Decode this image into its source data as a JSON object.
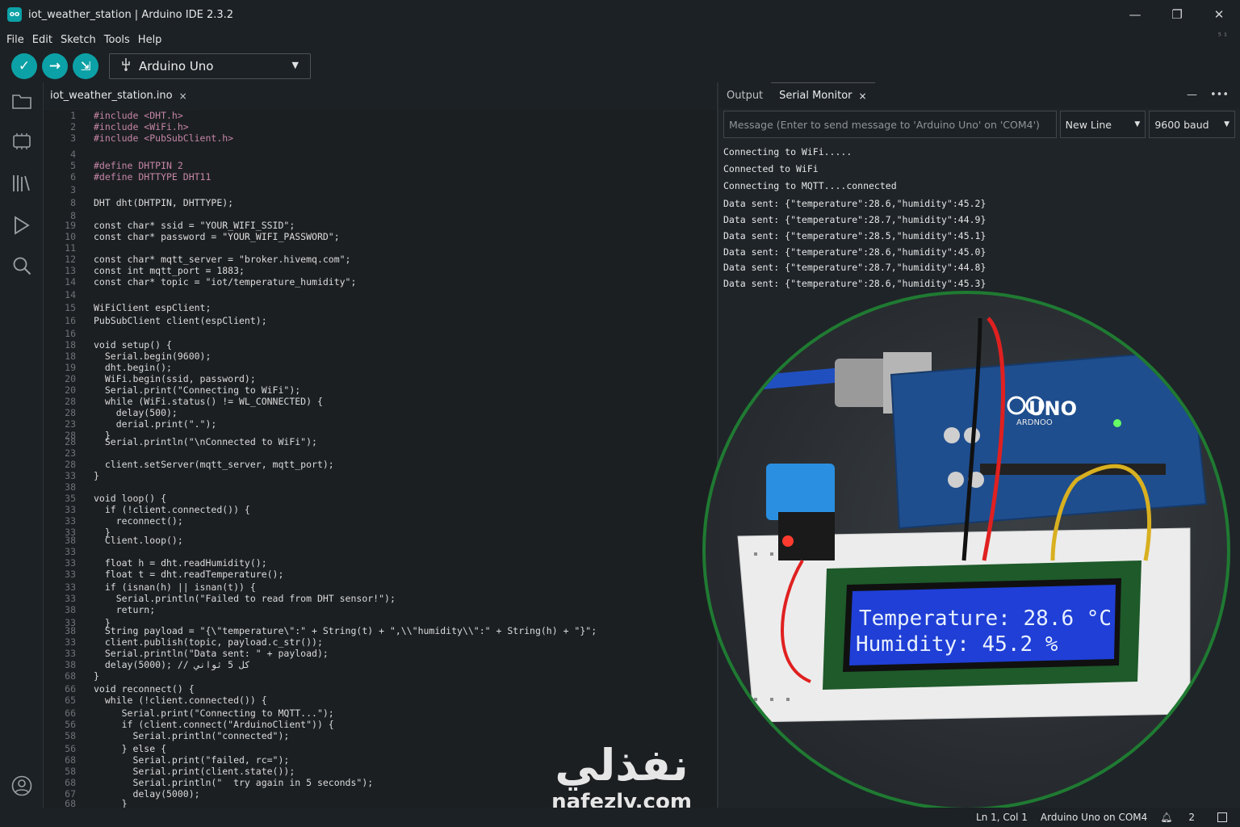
{
  "window": {
    "app_logo": "oo",
    "title": "iot_weather_station | Arduino IDE 2.3.2",
    "controls": {
      "minimize": "—",
      "maximize": "❐",
      "close": "✕"
    }
  },
  "menu": {
    "items": [
      "File",
      "Edit",
      "Sketch",
      "Tools",
      "Help"
    ],
    "right_hint": "⁵ ¹"
  },
  "toolbar": {
    "verify_icon": "✓",
    "upload_icon": "→",
    "debug_icon": "⇲",
    "board": "Arduino Uno",
    "board_chevron": "▼"
  },
  "sidebar": {
    "icons": [
      "folder-icon",
      "boards-icon",
      "library-icon",
      "debug-icon",
      "search-icon",
      "account-icon"
    ]
  },
  "editor": {
    "tab_label": "iot_weather_station.ino",
    "tab_close": "×",
    "lines": [
      {
        "n": "1",
        "t": "#include <DHT.h>"
      },
      {
        "n": "2",
        "t": "#include <WiFi.h>"
      },
      {
        "n": "3",
        "t": "#include <PubSubClient.h>"
      },
      {
        "n": "4",
        "t": ""
      },
      {
        "n": "5",
        "t": "#define DHTPIN 2"
      },
      {
        "n": "6",
        "t": "#define DHTTYPE DHT11"
      },
      {
        "n": "3",
        "t": ""
      },
      {
        "n": "8",
        "t": "DHT dht(DHTPIN, DHTTYPE);"
      },
      {
        "n": "8",
        "t": ""
      },
      {
        "n": "19",
        "t": "const char* ssid = \"YOUR_WIFI_SSID\";"
      },
      {
        "n": "10",
        "t": "const char* password = \"YOUR_WIFI_PASSWORD\";"
      },
      {
        "n": "11",
        "t": ""
      },
      {
        "n": "12",
        "t": "const char* mqtt_server = \"broker.hivemq.com\";"
      },
      {
        "n": "13",
        "t": "const int mqtt_port = 1883;"
      },
      {
        "n": "14",
        "t": "const char* topic = \"iot/temperature_humidity\";"
      },
      {
        "n": "14",
        "t": ""
      },
      {
        "n": "15",
        "t": "WiFiClient espClient;"
      },
      {
        "n": "16",
        "t": "PubSubClient client(espClient);"
      },
      {
        "n": "16",
        "t": ""
      },
      {
        "n": "18",
        "t": "void setup() {"
      },
      {
        "n": "18",
        "t": "  Serial.begin(9600);"
      },
      {
        "n": "19",
        "t": "  dht.begin();"
      },
      {
        "n": "20",
        "t": "  WiFi.begin(ssid, password);"
      },
      {
        "n": "20",
        "t": "  Serial.print(\"Connecting to WiFi\");"
      },
      {
        "n": "28",
        "t": "  while (WiFi.status() != WL_CONNECTED) {"
      },
      {
        "n": "28",
        "t": "    delay(500);"
      },
      {
        "n": "23",
        "t": "    derial.print(\".\");"
      },
      {
        "n": "28",
        "t": "  }"
      },
      {
        "n": "28",
        "t": "  Serial.println(\"\\nConnected to WiFi\");"
      },
      {
        "n": "23",
        "t": ""
      },
      {
        "n": "28",
        "t": "  client.setServer(mqtt_server, mqtt_port);"
      },
      {
        "n": "33",
        "t": "}"
      },
      {
        "n": "38",
        "t": ""
      },
      {
        "n": "35",
        "t": "void loop() {"
      },
      {
        "n": "33",
        "t": "  if (!client.connected()) {"
      },
      {
        "n": "33",
        "t": "    reconnect();"
      },
      {
        "n": "33",
        "t": "  }"
      },
      {
        "n": "38",
        "t": "  Client.loop();"
      },
      {
        "n": "33",
        "t": ""
      },
      {
        "n": "33",
        "t": "  float h = dht.readHumidity();"
      },
      {
        "n": "33",
        "t": "  float t = dht.readTemperature();"
      },
      {
        "n": "33",
        "t": "  if (isnan(h) || isnan(t)) {"
      },
      {
        "n": "33",
        "t": "    Serial.println(\"Failed to read from DHT sensor!\");"
      },
      {
        "n": "38",
        "t": "    return;"
      },
      {
        "n": "33",
        "t": "  }"
      },
      {
        "n": "38",
        "t": "  String payload = \"{\\\"temperature\\\":\" + String(t) + \",\\\\\"humidity\\\\\":\" + String(h) + \"}\";"
      },
      {
        "n": "33",
        "t": "  client.publish(topic, payload.c_str());"
      },
      {
        "n": "33",
        "t": "  Serial.println(\"Data sent: \" + payload);"
      },
      {
        "n": "38",
        "t": "  delay(5000); // كل 5 ثواني"
      },
      {
        "n": "68",
        "t": "}"
      },
      {
        "n": "66",
        "t": "void reconnect() {"
      },
      {
        "n": "65",
        "t": "  while (!client.connected()) {"
      },
      {
        "n": "66",
        "t": "     Serial.print(\"Connecting to MQTT...\");"
      },
      {
        "n": "56",
        "t": "     if (client.connect(\"ArduinoClient\")) {"
      },
      {
        "n": "58",
        "t": "       Serial.println(\"connected\");"
      },
      {
        "n": "56",
        "t": "     } else {"
      },
      {
        "n": "68",
        "t": "       Serial.print(\"failed, rc=\");"
      },
      {
        "n": "58",
        "t": "       Serial.print(client.state());"
      },
      {
        "n": "68",
        "t": "       Serial.println(\"  try again in 5 seconds\");"
      },
      {
        "n": "67",
        "t": "       delay(5000);"
      },
      {
        "n": "68",
        "t": "     }"
      }
    ]
  },
  "panel": {
    "tabs": [
      "Output",
      "Serial Monitor"
    ],
    "tab_close": "×",
    "collapse_icon": "—",
    "more_icon": "•••",
    "message_placeholder": "Message (Enter to send message to 'Arduino Uno' on 'COM4')",
    "line_ending": "New Line",
    "baud": "9600 baud",
    "chevron": "▼",
    "serial_output": [
      "Connecting to WiFi.....",
      "Connected to WiFi",
      "Connecting to MQTT....connected",
      "Data sent: {\"temperature\":28.6,\"humidity\":45.2}",
      "Data sent: {\"temperature\":28.7,\"humidity\":44.9}",
      "Data sent: {\"temperature\":28.5,\"humidity\":45.1}",
      "Data sent: {\"temperature\":28.6,\"humidity\":45.0}",
      "Data sent: {\"temperature\":28.7,\"humidity\":44.8}",
      "Data sent: {\"temperature\":28.6,\"humidity\":45.3}"
    ]
  },
  "photo": {
    "board_label": "UNO",
    "board_brand": "ARDNOO",
    "lcd_line1": "Temperature: 28.6 °C",
    "lcd_line2": "Humidity: 45.2 %",
    "ring_color": "#1f7a32",
    "lcd_color": "#1f3fd6"
  },
  "watermark": {
    "arabic": "نفذلي",
    "url": "nafezly.com"
  },
  "status": {
    "position": "Ln 1, Col 1",
    "board_port": "Arduino Uno on COM4",
    "notifications": "2"
  }
}
